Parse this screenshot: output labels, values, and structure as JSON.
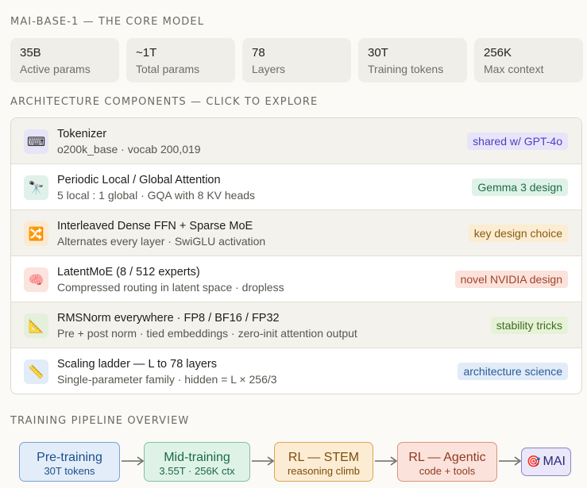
{
  "header": {
    "title": "MAI-BASE-1 — THE CORE MODEL"
  },
  "stats": [
    {
      "value": "35B",
      "label": "Active params"
    },
    {
      "value": "~1T",
      "label": "Total params"
    },
    {
      "value": "78",
      "label": "Layers"
    },
    {
      "value": "30T",
      "label": "Training tokens"
    },
    {
      "value": "256K",
      "label": "Max context"
    }
  ],
  "architecture": {
    "title": "ARCHITECTURE COMPONENTS — CLICK TO EXPLORE",
    "components": [
      {
        "icon": "keyboard-icon",
        "glyph": "⌨",
        "title": "Tokenizer",
        "subtitle": "o200k_base · vocab 200,019",
        "tag": "shared w/ GPT-4o",
        "tag_color": "#4b3fbf",
        "tag_bg": "#e8e5fa",
        "icon_bg": "#e6e4f7"
      },
      {
        "icon": "telescope-icon",
        "glyph": "🔭",
        "title": "Periodic Local / Global Attention",
        "subtitle": "5 local : 1 global · GQA with 8 KV heads",
        "tag": "Gemma 3 design",
        "tag_color": "#1e6b4a",
        "tag_bg": "#dff2e8",
        "icon_bg": "#e0f1ea"
      },
      {
        "icon": "shuffle-icon",
        "glyph": "🔀",
        "title": "Interleaved Dense FFN + Sparse MoE",
        "subtitle": "Alternates every layer · SwiGLU activation",
        "tag": "key design choice",
        "tag_color": "#8a5a10",
        "tag_bg": "#fbecd2",
        "icon_bg": "#fbead0"
      },
      {
        "icon": "brain-icon",
        "glyph": "🧠",
        "title": "LatentMoE (8 / 512 experts)",
        "subtitle": "Compressed routing in latent space · dropless",
        "tag": "novel NVIDIA design",
        "tag_color": "#a2432c",
        "tag_bg": "#fbe3db",
        "icon_bg": "#fbe4dd"
      },
      {
        "icon": "triangle-ruler-icon",
        "glyph": "📐",
        "title": "RMSNorm everywhere · FP8 / BF16 / FP32",
        "subtitle": "Pre + post norm · tied embeddings · zero-init attention output",
        "tag": "stability tricks",
        "tag_color": "#3f6b1c",
        "tag_bg": "#e6f2d8",
        "icon_bg": "#e5f0dc"
      },
      {
        "icon": "ruler-icon",
        "glyph": "📏",
        "title": "Scaling ladder — L to 78 layers",
        "subtitle": "Single-parameter family · hidden = L × 256/3",
        "tag": "architecture science",
        "tag_color": "#2a5b9a",
        "tag_bg": "#e1ecf8",
        "icon_bg": "#e1ecf8"
      }
    ]
  },
  "pipeline": {
    "title": "TRAINING PIPELINE OVERVIEW",
    "stages": [
      {
        "title": "Pre-training",
        "subtitle": "30T tokens",
        "color": "#1e4e8c",
        "bg": "#e2edf9",
        "border": "#7aa3d6"
      },
      {
        "title": "Mid-training",
        "subtitle": "3.55T · 256K ctx",
        "color": "#1b6a47",
        "bg": "#dff2e8",
        "border": "#7cc4a0"
      },
      {
        "title": "RL — STEM",
        "subtitle": "reasoning climb",
        "color": "#7d4e0c",
        "bg": "#fcecd3",
        "border": "#d9a65a"
      },
      {
        "title": "RL — Agentic",
        "subtitle": "code + tools",
        "color": "#8e3a23",
        "bg": "#fbe3db",
        "border": "#d99583"
      }
    ],
    "final": {
      "glyph": "🎯",
      "icon": "target-icon",
      "label": "MAI"
    }
  }
}
